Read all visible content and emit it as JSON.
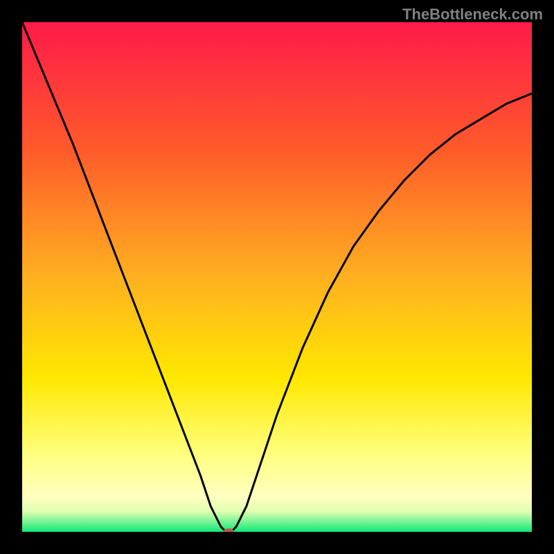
{
  "watermark": "TheBottleneck.com",
  "chart_data": {
    "type": "line",
    "title": "",
    "xlabel": "",
    "ylabel": "",
    "xlim": [
      0,
      100
    ],
    "ylim": [
      0,
      100
    ],
    "background_gradient": {
      "stops": [
        {
          "offset": 0,
          "color": "#ff1a4a"
        },
        {
          "offset": 25,
          "color": "#ff5a2a"
        },
        {
          "offset": 50,
          "color": "#ffb020"
        },
        {
          "offset": 70,
          "color": "#ffe800"
        },
        {
          "offset": 85,
          "color": "#ffff80"
        },
        {
          "offset": 93,
          "color": "#ffffc0"
        },
        {
          "offset": 96,
          "color": "#e0ffb0"
        },
        {
          "offset": 100,
          "color": "#10e878"
        }
      ]
    },
    "series": [
      {
        "name": "curve",
        "color": "#000000",
        "x": [
          0,
          5,
          10,
          15,
          20,
          25,
          30,
          35,
          37,
          39,
          40,
          41,
          42,
          44,
          47,
          50,
          55,
          60,
          65,
          70,
          75,
          80,
          85,
          90,
          95,
          100
        ],
        "y": [
          100,
          88,
          76,
          63,
          50,
          37,
          24,
          11,
          5,
          1,
          0,
          0,
          1,
          5,
          14,
          23,
          36,
          47,
          56,
          63,
          69,
          74,
          78,
          81,
          84,
          86
        ]
      }
    ],
    "marker": {
      "x": 40.5,
      "y": 0,
      "color": "#b85a4a",
      "rx": 8,
      "ry": 5
    }
  }
}
